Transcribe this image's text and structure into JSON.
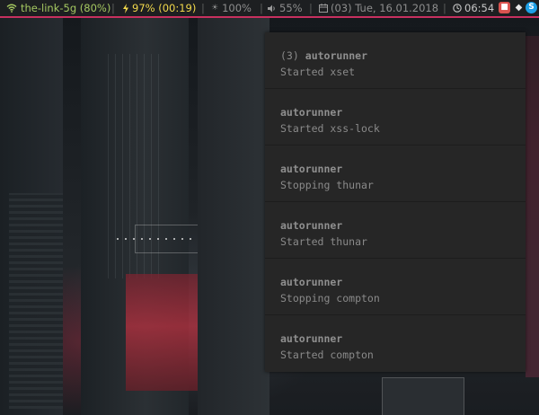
{
  "statusbar": {
    "wifi": {
      "icon": "wifi-icon",
      "label": "the-link-5g (80%)"
    },
    "battery": {
      "icon": "lightning-icon",
      "label": "97% (00:19)"
    },
    "brightness": {
      "icon": "sun-icon",
      "label": "100%"
    },
    "volume": {
      "icon": "speaker-icon",
      "label": "55%"
    },
    "date": {
      "icon": "calendar-icon",
      "label": "(03) Tue, 16.01.2018"
    },
    "time": {
      "icon": "clock-icon",
      "label": "06:54"
    },
    "separator": "|",
    "tray": [
      {
        "icon": "app-tray-icon",
        "color": "#d9534f"
      },
      {
        "icon": "dropbox-tray-icon",
        "color": "#2e7bd6"
      },
      {
        "icon": "skype-tray-icon",
        "color": "#1ea0e6"
      }
    ]
  },
  "colors": {
    "bar_background": "#1d1f21",
    "bar_accent": "#c7305f",
    "wifi_green": "#a5c861",
    "battery_yellow": "#f2d94b",
    "notification_background": "#262626"
  },
  "notifications": [
    {
      "count": "(3)",
      "app": "autorunner",
      "body": "Started xset"
    },
    {
      "count": "",
      "app": "autorunner",
      "body": "Started xss-lock"
    },
    {
      "count": "",
      "app": "autorunner",
      "body": "Stopping thunar"
    },
    {
      "count": "",
      "app": "autorunner",
      "body": "Started thunar"
    },
    {
      "count": "",
      "app": "autorunner",
      "body": "Stopping compton"
    },
    {
      "count": "",
      "app": "autorunner",
      "body": "Started compton"
    }
  ]
}
